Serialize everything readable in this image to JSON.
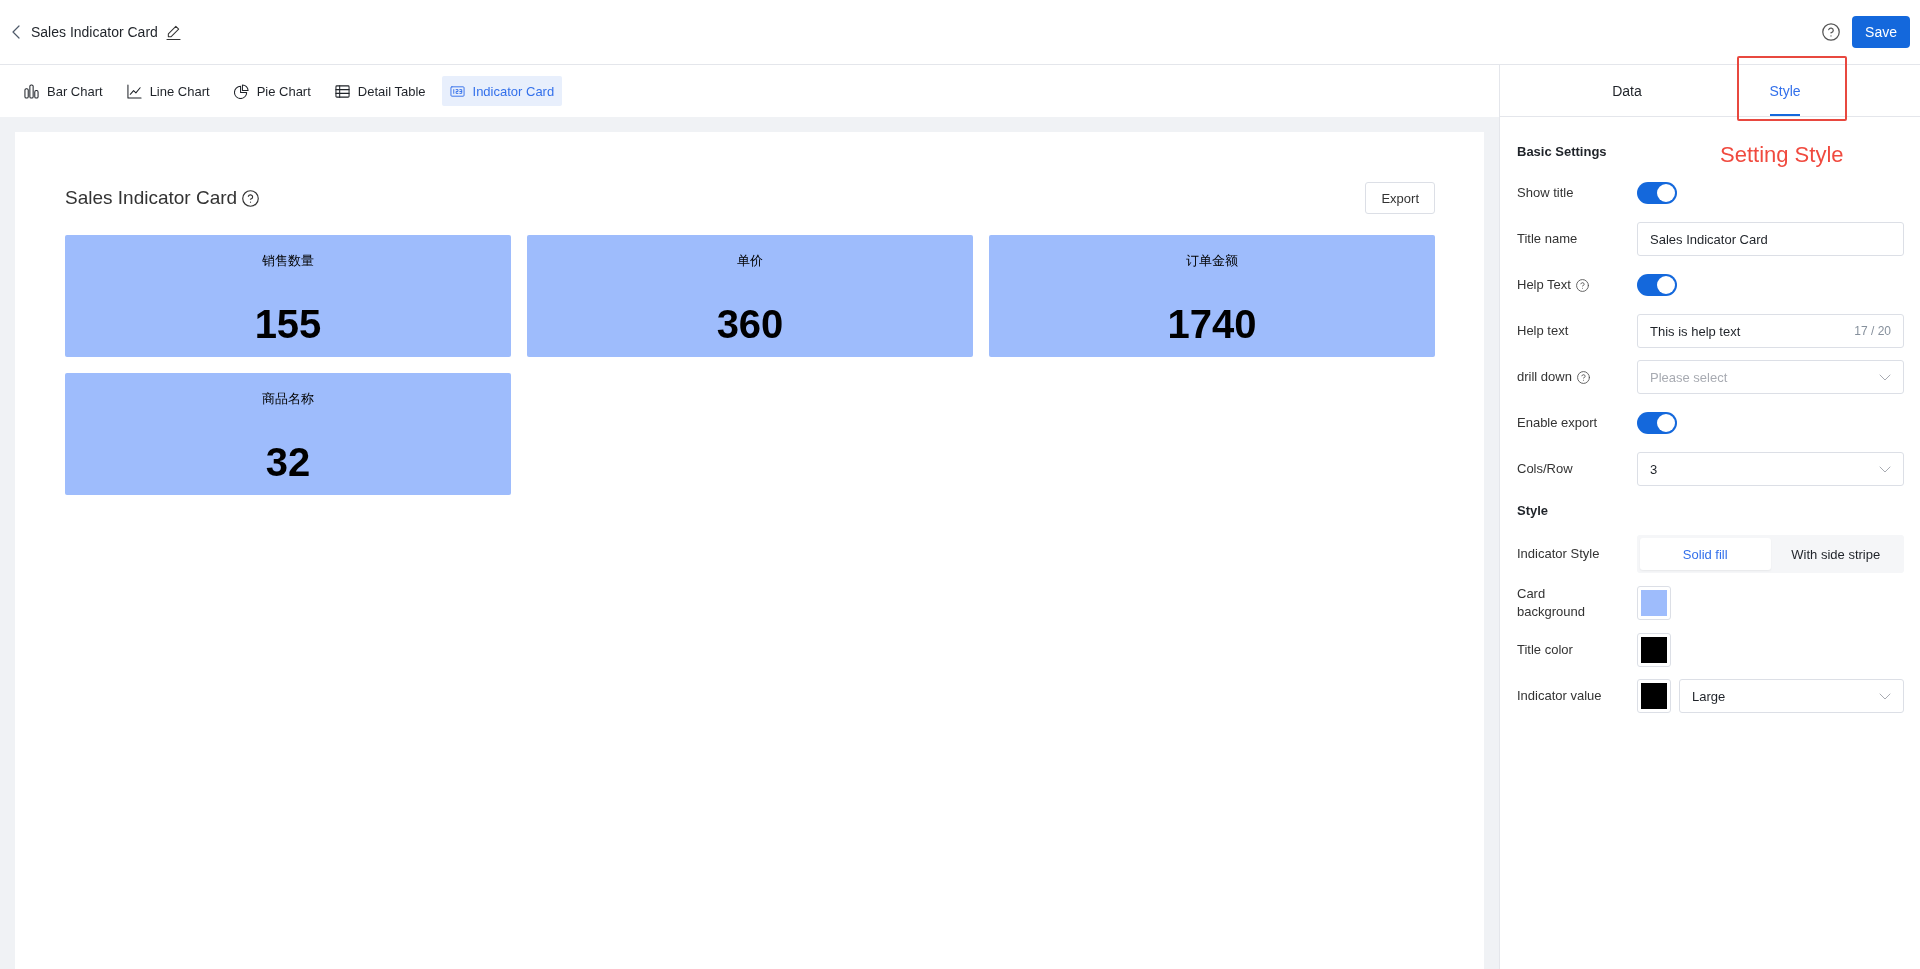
{
  "header": {
    "title": "Sales Indicator Card",
    "save_label": "Save"
  },
  "chart_types": [
    {
      "kind": "bar",
      "label": "Bar Chart",
      "selected": false
    },
    {
      "kind": "line",
      "label": "Line Chart",
      "selected": false
    },
    {
      "kind": "pie",
      "label": "Pie Chart",
      "selected": false
    },
    {
      "kind": "table",
      "label": "Detail Table",
      "selected": false
    },
    {
      "kind": "card",
      "label": "Indicator Card",
      "selected": true
    }
  ],
  "chart": {
    "title": "Sales Indicator Card",
    "export_label": "Export",
    "indicators": [
      {
        "label": "销售数量",
        "value": "155"
      },
      {
        "label": "单价",
        "value": "360"
      },
      {
        "label": "订单金额",
        "value": "1740"
      },
      {
        "label": "商品名称",
        "value": "32"
      }
    ]
  },
  "panel_tabs": [
    {
      "label": "Data",
      "selected": false
    },
    {
      "label": "Style",
      "selected": true
    }
  ],
  "annotation": {
    "label": "Setting Style"
  },
  "basic": {
    "title": "Basic Settings",
    "rows": [
      {
        "kind": "switch",
        "label": "Show title",
        "help": false,
        "on": true
      },
      {
        "kind": "input",
        "label": "Title name",
        "help": false,
        "value": "Sales Indicator Card"
      },
      {
        "kind": "switch",
        "label": "Help Text",
        "help": true,
        "on": true
      },
      {
        "kind": "input",
        "label": "Help text",
        "help": false,
        "value": "This is help text",
        "count": "17 / 20"
      },
      {
        "kind": "select",
        "label": "drill down",
        "help": true,
        "placeholder": "Please select"
      },
      {
        "kind": "switch",
        "label": "Enable export",
        "help": false,
        "on": true
      },
      {
        "kind": "select",
        "label": "Cols/Row",
        "help": false,
        "value": "3"
      }
    ]
  },
  "style": {
    "title": "Style",
    "rows": [
      {
        "kind": "segmented",
        "label": "Indicator Style",
        "help": false,
        "options": [
          {
            "label": "Solid fill",
            "selected": true
          },
          {
            "label": "With side stripe",
            "selected": false
          }
        ]
      },
      {
        "kind": "color",
        "label": "Card background",
        "help": false,
        "color": "#9ebcfc"
      },
      {
        "kind": "color",
        "label": "Title color",
        "help": false,
        "color": "#000000"
      },
      {
        "kind": "color_select",
        "label": "Indicator value",
        "help": false,
        "color": "#000000",
        "value": "Large"
      }
    ]
  }
}
